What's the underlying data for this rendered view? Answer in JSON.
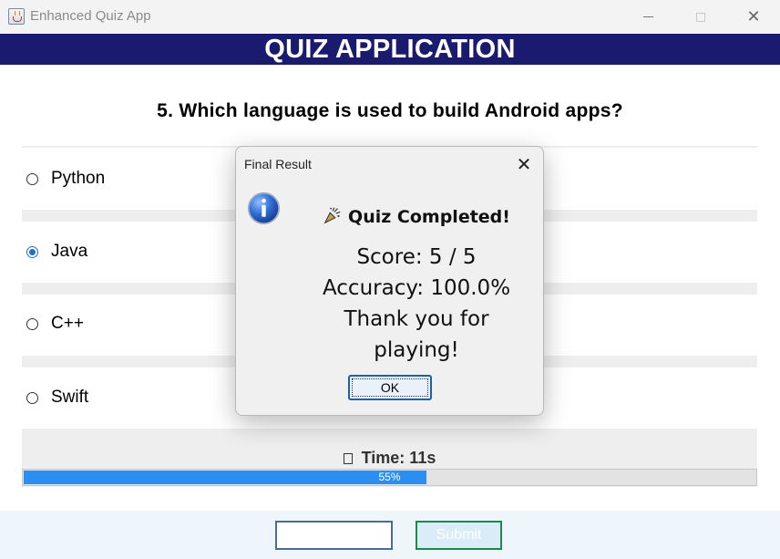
{
  "window": {
    "title": "Enhanced Quiz App"
  },
  "header": {
    "title": "QUIZ APPLICATION"
  },
  "question": {
    "text": "5. Which language is used to build Android apps?"
  },
  "options": [
    {
      "label": "Python",
      "selected": false
    },
    {
      "label": "Java",
      "selected": true
    },
    {
      "label": "C++",
      "selected": false
    },
    {
      "label": "Swift",
      "selected": false
    }
  ],
  "timer": {
    "icon": "timer-icon",
    "text": "Time: 11s",
    "progress_label": "55%",
    "progress_value": 55
  },
  "bottom": {
    "answer_value": "",
    "submit_label": "Submit"
  },
  "dialog": {
    "title": "Final Result",
    "heading": "Quiz Completed!",
    "heading_icon": "party-popper-icon",
    "score": "Score: 5 / 5",
    "accuracy": "Accuracy: 100.0%",
    "thanks_line1": "Thank you for",
    "thanks_line2": "playing!",
    "ok_label": "OK"
  },
  "colors": {
    "banner": "#1a1a6e",
    "progress": "#2b8ff2",
    "radio_selected": "#1d6fc7",
    "submit_border": "#1a8a4a"
  }
}
